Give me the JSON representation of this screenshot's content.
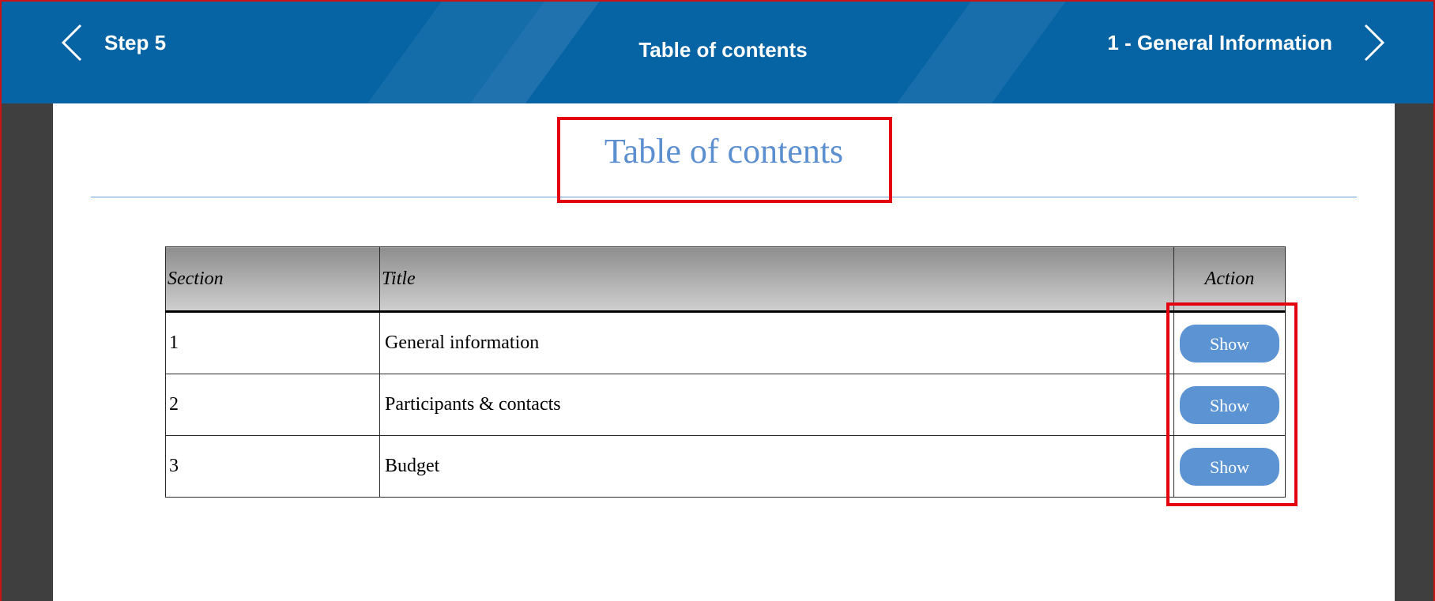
{
  "header": {
    "prev_label": "Step 5",
    "title": "Table of contents",
    "next_label": "1 - General Information"
  },
  "document": {
    "title": "Table of contents",
    "table": {
      "columns": [
        "Section",
        "Title",
        "Action"
      ],
      "rows": [
        {
          "section": "1",
          "title": "General information",
          "action": "Show"
        },
        {
          "section": "2",
          "title": "Participants & contacts",
          "action": "Show"
        },
        {
          "section": "3",
          "title": "Budget",
          "action": "Show"
        }
      ]
    }
  },
  "colors": {
    "header_bg": "#0663a4",
    "accent": "#5b93d3",
    "highlight": "#e3000f",
    "dark_bg": "#3f3f3f"
  },
  "icons": {
    "prev": "chevron-left-icon",
    "next": "chevron-right-icon"
  }
}
